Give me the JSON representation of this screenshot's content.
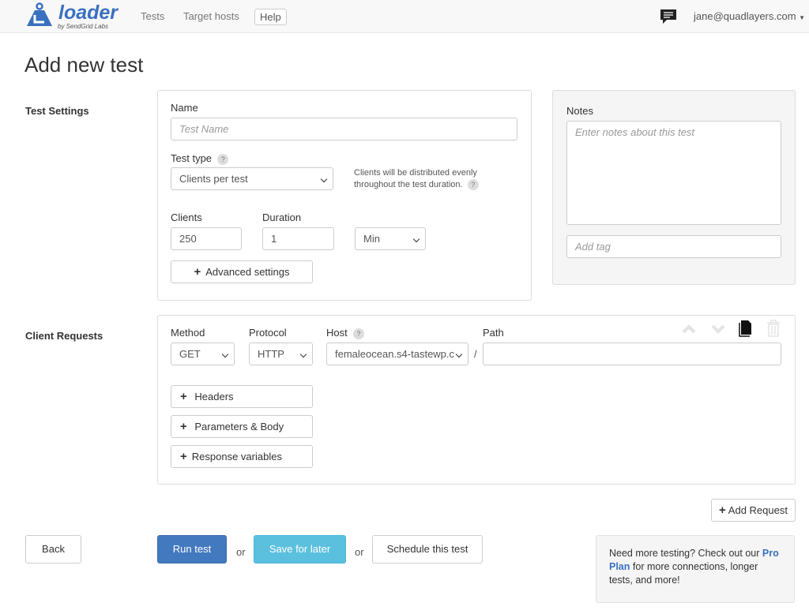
{
  "nav": {
    "logo": "loader",
    "logo_sub": "by SendGrid Labs",
    "links": [
      "Tests",
      "Target hosts"
    ],
    "help": "Help",
    "user": "jane@quadlayers.com"
  },
  "page": {
    "title": "Add new test"
  },
  "settings": {
    "section": "Test Settings",
    "name_label": "Name",
    "name_placeholder": "Test Name",
    "type_label": "Test type",
    "type_value": "Clients per test",
    "type_hint": "Clients will be distributed evenly throughout the test duration.",
    "clients_label": "Clients",
    "clients_value": "250",
    "duration_label": "Duration",
    "duration_value": "1",
    "unit_value": "Min",
    "advanced": "Advanced settings",
    "help_glyph": "?"
  },
  "notes": {
    "label": "Notes",
    "placeholder": "Enter notes about this test",
    "tag_placeholder": "Add tag"
  },
  "requests": {
    "section": "Client Requests",
    "method_label": "Method",
    "method_value": "GET",
    "protocol_label": "Protocol",
    "protocol_value": "HTTP",
    "host_label": "Host",
    "host_value": "femaleocean.s4-tastewp.c",
    "path_label": "Path",
    "path_value": "",
    "slash": "/",
    "headers": "Headers",
    "params": "Parameters & Body",
    "response": "Response variables",
    "add_request": "Add Request"
  },
  "actions": {
    "back": "Back",
    "run": "Run test",
    "or": "or",
    "save": "Save for later",
    "schedule": "Schedule this test"
  },
  "promo": {
    "text1": "Need more testing? Check out our",
    "link": "Pro Plan",
    "text2": "for more connections, longer tests, and more!"
  },
  "colors": {
    "brand": "#3a70c0",
    "primary": "#4279bf",
    "info": "#5bc0de"
  }
}
